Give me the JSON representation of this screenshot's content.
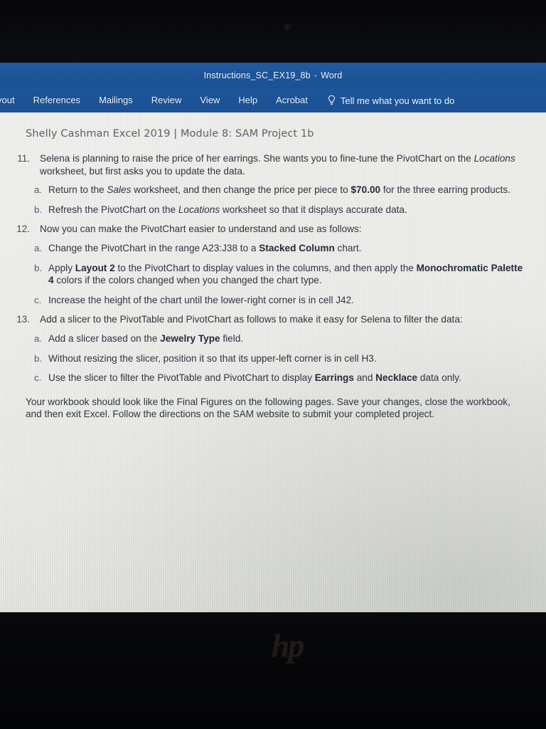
{
  "device": {
    "brand_logo": "hp",
    "webcam": "webcam-dot"
  },
  "window": {
    "title_name": "Instructions_SC_EX19_8b",
    "title_sep": "-",
    "title_app": "Word"
  },
  "ribbon": {
    "tabs": [
      {
        "label": "yout",
        "name": "tab-layout"
      },
      {
        "label": "References",
        "name": "tab-references"
      },
      {
        "label": "Mailings",
        "name": "tab-mailings"
      },
      {
        "label": "Review",
        "name": "tab-review"
      },
      {
        "label": "View",
        "name": "tab-view"
      },
      {
        "label": "Help",
        "name": "tab-help"
      },
      {
        "label": "Acrobat",
        "name": "tab-acrobat"
      }
    ],
    "tell_me": "Tell me what you want to do",
    "tell_me_icon": "lightbulb-icon"
  },
  "document": {
    "header": "Shelly Cashman Excel 2019  |  Module 8: SAM Project 1b",
    "steps": [
      {
        "number": "11.",
        "text_parts": [
          {
            "t": "Selena is planning to raise the price of her earrings. She wants you to fine-tune the PivotChart on the "
          },
          {
            "t": "Locations",
            "s": "i"
          },
          {
            "t": " worksheet, but first asks you to update the data."
          }
        ],
        "subs": [
          {
            "letter": "a.",
            "text_parts": [
              {
                "t": "Return to the "
              },
              {
                "t": "Sales",
                "s": "i"
              },
              {
                "t": " worksheet, and then change the price per piece to "
              },
              {
                "t": "$70.00",
                "s": "b"
              },
              {
                "t": " for the three earring products."
              }
            ]
          },
          {
            "letter": "b.",
            "text_parts": [
              {
                "t": "Refresh the PivotChart on the "
              },
              {
                "t": "Locations",
                "s": "i"
              },
              {
                "t": " worksheet so that it displays accurate data."
              }
            ]
          }
        ]
      },
      {
        "number": "12.",
        "text_parts": [
          {
            "t": "Now you can make the PivotChart easier to understand and use as follows:"
          }
        ],
        "subs": [
          {
            "letter": "a.",
            "text_parts": [
              {
                "t": "Change the PivotChart in the range A23:J38 to a "
              },
              {
                "t": "Stacked Column",
                "s": "b"
              },
              {
                "t": " chart."
              }
            ]
          },
          {
            "letter": "b.",
            "text_parts": [
              {
                "t": "Apply "
              },
              {
                "t": "Layout 2",
                "s": "b"
              },
              {
                "t": " to the PivotChart to display values in the columns, and then apply the "
              },
              {
                "t": "Monochromatic Palette 4",
                "s": "b"
              },
              {
                "t": " colors if the colors changed when you changed the chart type."
              }
            ]
          },
          {
            "letter": "c.",
            "text_parts": [
              {
                "t": "Increase the height of the chart until the lower-right corner is in cell J42."
              }
            ]
          }
        ]
      },
      {
        "number": "13.",
        "text_parts": [
          {
            "t": "Add a slicer to the PivotTable and PivotChart as follows to make it easy for Selena to filter the data:"
          }
        ],
        "subs": [
          {
            "letter": "a.",
            "text_parts": [
              {
                "t": "Add a slicer based on the "
              },
              {
                "t": "Jewelry Type",
                "s": "b"
              },
              {
                "t": " field."
              }
            ]
          },
          {
            "letter": "b.",
            "text_parts": [
              {
                "t": "Without resizing the slicer, position it so that its upper-left corner is in cell H3."
              }
            ]
          },
          {
            "letter": "c.",
            "text_parts": [
              {
                "t": "Use the slicer to filter the PivotTable and PivotChart to display "
              },
              {
                "t": "Earrings",
                "s": "b"
              },
              {
                "t": " and "
              },
              {
                "t": "Necklace",
                "s": "b"
              },
              {
                "t": " data only."
              }
            ]
          }
        ]
      }
    ],
    "closing_parts": [
      {
        "t": "Your workbook should look like the Final Figures on the following pages. Save your changes, close the workbook, and then exit Excel. Follow the directions on the SAM website to submit your completed project."
      }
    ]
  },
  "taskbar": {
    "tray_icons": [
      {
        "name": "atom-icon"
      },
      {
        "name": "person-avatar-icon"
      }
    ],
    "items": [
      {
        "name": "task-view-icon",
        "active": false
      },
      {
        "name": "firefox-icon",
        "active": true
      },
      {
        "name": "word-icon",
        "active": true
      },
      {
        "name": "edge-icon",
        "active": true
      },
      {
        "name": "file-explorer-icon",
        "active": true
      },
      {
        "name": "microsoft-store-icon",
        "active": false
      },
      {
        "name": "teal-flower-icon",
        "active": true
      },
      {
        "name": "prime-video-icon",
        "active": true
      },
      {
        "name": "excel-icon",
        "active": true
      }
    ]
  },
  "colors": {
    "ribbon_blue": "#1d5598",
    "taskbar_navy": "#111c2b",
    "doc_paper": "#e9e9e6",
    "list_marker": "#4a5a73",
    "body_text": "#2f3640"
  }
}
